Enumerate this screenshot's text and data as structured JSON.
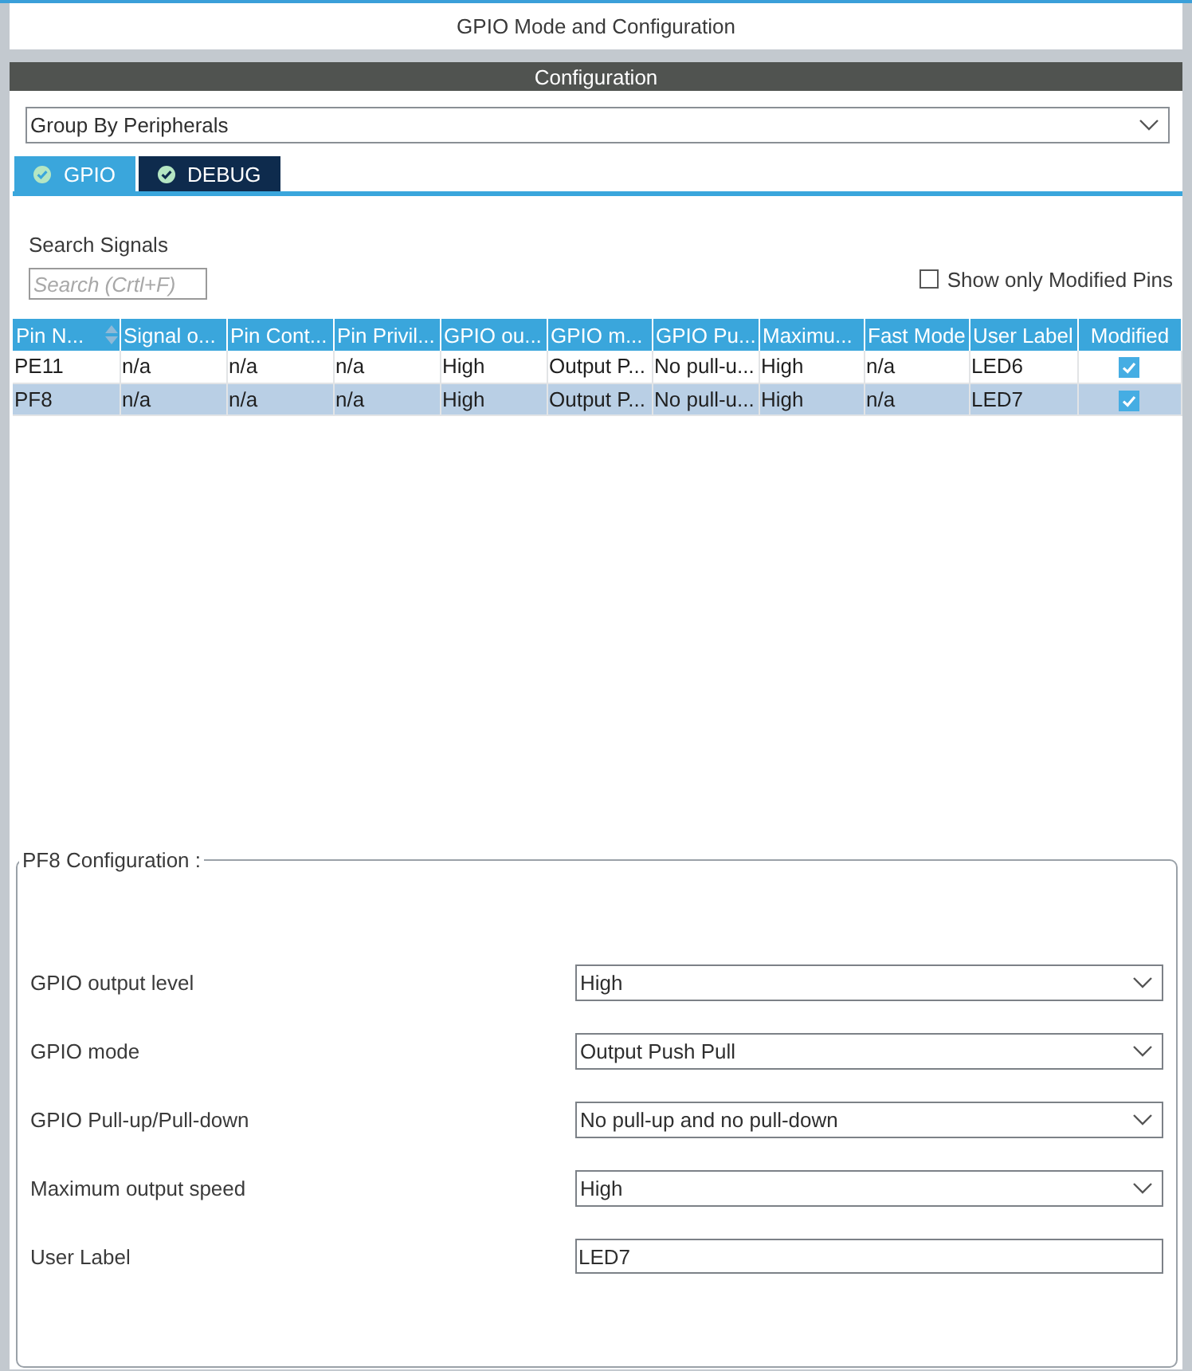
{
  "window": {
    "title": "GPIO Mode and Configuration"
  },
  "configuration": {
    "header": "Configuration",
    "group_by": {
      "value": "Group By Peripherals"
    },
    "tabs": [
      {
        "label": "GPIO",
        "selected": true
      },
      {
        "label": "DEBUG",
        "selected": false
      }
    ]
  },
  "signals": {
    "search_label": "Search Signals",
    "search": {
      "placeholder": "Search (Crtl+F)"
    },
    "show_modified": {
      "label": "Show only Modified Pins",
      "checked": false
    }
  },
  "table": {
    "columns": [
      {
        "label": "Pin N...",
        "sorted": true
      },
      {
        "label": "Signal o..."
      },
      {
        "label": "Pin Cont..."
      },
      {
        "label": "Pin Privil..."
      },
      {
        "label": "GPIO ou..."
      },
      {
        "label": "GPIO m..."
      },
      {
        "label": "GPIO Pu..."
      },
      {
        "label": "Maximu..."
      },
      {
        "label": "Fast Mode"
      },
      {
        "label": "User Label"
      },
      {
        "label": "Modified"
      }
    ],
    "rows": [
      {
        "cells": [
          "PE11",
          "n/a",
          "n/a",
          "n/a",
          "High",
          "Output P...",
          "No pull-u...",
          "High",
          "n/a",
          "LED6"
        ],
        "modified": true,
        "selected": false
      },
      {
        "cells": [
          "PF8",
          "n/a",
          "n/a",
          "n/a",
          "High",
          "Output P...",
          "No pull-u...",
          "High",
          "n/a",
          "LED7"
        ],
        "modified": true,
        "selected": true
      }
    ]
  },
  "pin_configuration": {
    "title": "PF8 Configuration :",
    "fields": [
      {
        "kind": "select",
        "label": "GPIO output level",
        "value": "High"
      },
      {
        "kind": "select",
        "label": "GPIO mode",
        "value": "Output Push Pull"
      },
      {
        "kind": "select",
        "label": "GPIO Pull-up/Pull-down",
        "value": "No pull-up and no pull-down"
      },
      {
        "kind": "select",
        "label": "Maximum output speed",
        "value": "High"
      },
      {
        "kind": "text",
        "label": "User Label",
        "value": "LED7"
      }
    ]
  }
}
